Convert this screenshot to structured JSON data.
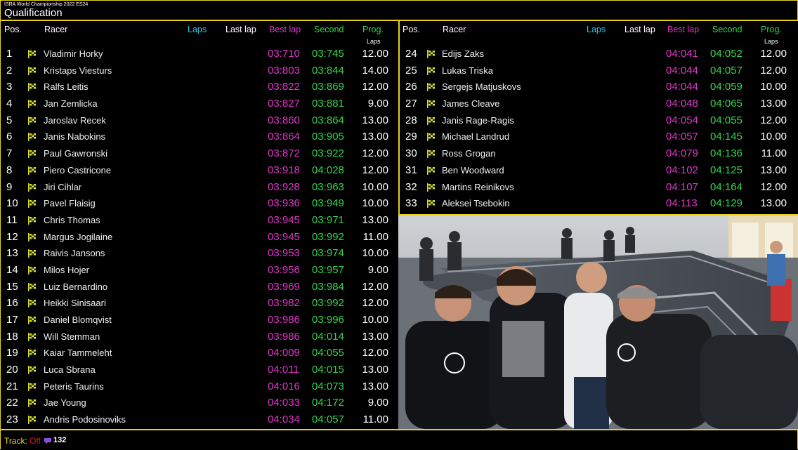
{
  "header": {
    "subtitle": "ISRA World Championship 2022 ES24",
    "title": "Qualification"
  },
  "columns": {
    "pos": "Pos.",
    "racer": "Racer",
    "laps": "Laps",
    "last_lap": "Last lap",
    "best_lap": "Best lap",
    "second": "Second",
    "prog": "Prog.",
    "prog_sub": "Laps"
  },
  "colors": {
    "accent": "#e6d21e",
    "best_lap": "#e235c9",
    "second": "#34d64a",
    "laps_header": "#2fc4e8"
  },
  "icons": {
    "row_flag": "checkered-flag-icon",
    "track_icon": "track-icon"
  },
  "left_rows": [
    {
      "pos": "1",
      "name": "Vladimir Horky",
      "best": "03:710",
      "second": "03:745",
      "prog": "12.00"
    },
    {
      "pos": "2",
      "name": "Kristaps Viesturs",
      "best": "03:803",
      "second": "03:844",
      "prog": "14.00"
    },
    {
      "pos": "3",
      "name": "Ralfs Leitis",
      "best": "03:822",
      "second": "03:869",
      "prog": "12.00"
    },
    {
      "pos": "4",
      "name": "Jan Zemlicka",
      "best": "03:827",
      "second": "03:881",
      "prog": "9.00"
    },
    {
      "pos": "5",
      "name": "Jaroslav Recek",
      "best": "03:860",
      "second": "03:864",
      "prog": "13.00"
    },
    {
      "pos": "6",
      "name": "Janis Nabokins",
      "best": "03:864",
      "second": "03:905",
      "prog": "13.00"
    },
    {
      "pos": "7",
      "name": "Paul Gawronski",
      "best": "03:872",
      "second": "03:922",
      "prog": "12.00"
    },
    {
      "pos": "8",
      "name": "Piero Castricone",
      "best": "03:918",
      "second": "04:028",
      "prog": "12.00"
    },
    {
      "pos": "9",
      "name": "Jiri Cihlar",
      "best": "03:928",
      "second": "03:963",
      "prog": "10.00"
    },
    {
      "pos": "10",
      "name": "Pavel Flaisig",
      "best": "03:936",
      "second": "03:949",
      "prog": "10.00"
    },
    {
      "pos": "11",
      "name": "Chris Thomas",
      "best": "03:945",
      "second": "03:971",
      "prog": "13.00"
    },
    {
      "pos": "12",
      "name": "Margus Jogilaine",
      "best": "03:945",
      "second": "03:992",
      "prog": "11.00"
    },
    {
      "pos": "13",
      "name": "Raivis Jansons",
      "best": "03:953",
      "second": "03:974",
      "prog": "10.00"
    },
    {
      "pos": "14",
      "name": "Milos Hojer",
      "best": "03:956",
      "second": "03:957",
      "prog": "9.00"
    },
    {
      "pos": "15",
      "name": "Luiz Bernardino",
      "best": "03:969",
      "second": "03:984",
      "prog": "12.00"
    },
    {
      "pos": "16",
      "name": "Heikki Sinisaari",
      "best": "03:982",
      "second": "03:992",
      "prog": "12.00"
    },
    {
      "pos": "17",
      "name": "Daniel Blomqvist",
      "best": "03:986",
      "second": "03:996",
      "prog": "10.00"
    },
    {
      "pos": "18",
      "name": "Will Stemman",
      "best": "03:986",
      "second": "04:014",
      "prog": "13.00"
    },
    {
      "pos": "19",
      "name": "Kaiar Tammeleht",
      "best": "04:009",
      "second": "04:055",
      "prog": "12.00"
    },
    {
      "pos": "20",
      "name": "Luca Sbrana",
      "best": "04:011",
      "second": "04:015",
      "prog": "13.00"
    },
    {
      "pos": "21",
      "name": "Peteris Taurins",
      "best": "04:016",
      "second": "04:073",
      "prog": "13.00"
    },
    {
      "pos": "22",
      "name": "Jae Young",
      "best": "04:033",
      "second": "04:172",
      "prog": "9.00"
    },
    {
      "pos": "23",
      "name": "Andris Podosinoviks",
      "best": "04:034",
      "second": "04:057",
      "prog": "11.00"
    }
  ],
  "right_rows": [
    {
      "pos": "24",
      "name": "Edijs Zaks",
      "best": "04:041",
      "second": "04:052",
      "prog": "12.00"
    },
    {
      "pos": "25",
      "name": "Lukas Triska",
      "best": "04:044",
      "second": "04:057",
      "prog": "12.00"
    },
    {
      "pos": "26",
      "name": "Sergejs Matjuskovs",
      "best": "04:044",
      "second": "04:059",
      "prog": "10.00"
    },
    {
      "pos": "27",
      "name": "James Cleave",
      "best": "04:048",
      "second": "04:065",
      "prog": "13.00"
    },
    {
      "pos": "28",
      "name": "Janis Rage-Ragis",
      "best": "04:054",
      "second": "04:055",
      "prog": "12.00"
    },
    {
      "pos": "29",
      "name": "Michael Landrud",
      "best": "04:057",
      "second": "04:145",
      "prog": "10.00"
    },
    {
      "pos": "30",
      "name": "Ross Grogan",
      "best": "04:079",
      "second": "04:136",
      "prog": "11.00"
    },
    {
      "pos": "31",
      "name": "Ben Woodward",
      "best": "04:102",
      "second": "04:125",
      "prog": "13.00"
    },
    {
      "pos": "32",
      "name": "Martins Reinikovs",
      "best": "04:107",
      "second": "04:164",
      "prog": "12.00"
    },
    {
      "pos": "33",
      "name": "Aleksei Tsebokin",
      "best": "04:113",
      "second": "04:129",
      "prog": "13.00"
    }
  ],
  "footer": {
    "track_label": "Track:",
    "track_status": "Off",
    "count": "132"
  }
}
